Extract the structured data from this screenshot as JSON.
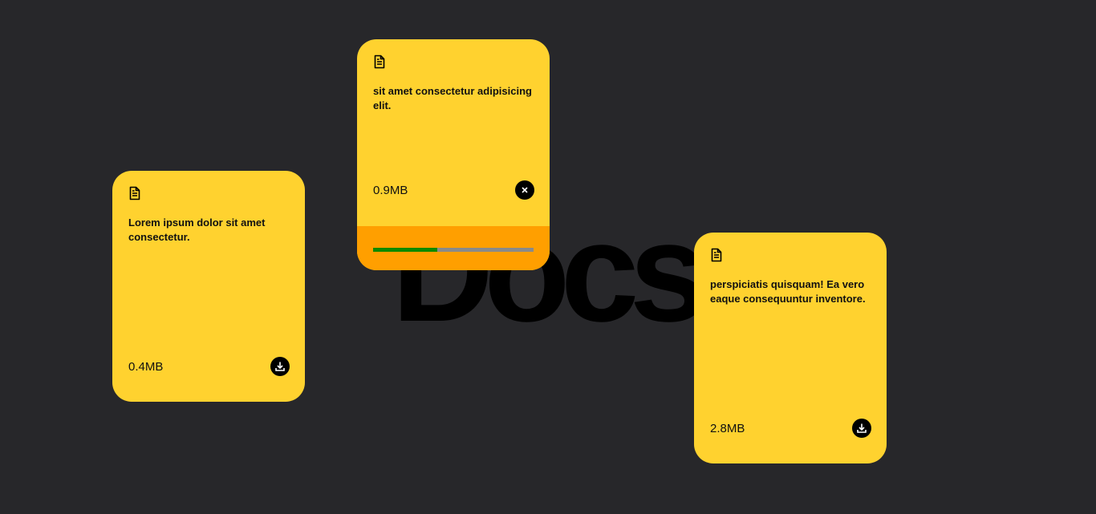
{
  "background_title": "Docs.",
  "colors": {
    "background": "#27272a",
    "card": "#ffd22f",
    "tag_strip": "#ff9f00",
    "progress_fill": "#0c8a00",
    "progress_track": "#8a8a8a"
  },
  "cards": [
    {
      "icon": "document-icon",
      "description": "Lorem ipsum dolor sit amet consectetur.",
      "size": "0.4MB",
      "action_icon": "download-icon"
    },
    {
      "icon": "document-icon",
      "description": "sit amet consectetur adipisicing elit.",
      "size": "0.9MB",
      "action_icon": "close-icon",
      "progress_percent": 40
    },
    {
      "icon": "document-icon",
      "description": "perspiciatis quisquam! Ea vero eaque consequuntur inventore.",
      "size": "2.8MB",
      "action_icon": "download-icon"
    }
  ]
}
